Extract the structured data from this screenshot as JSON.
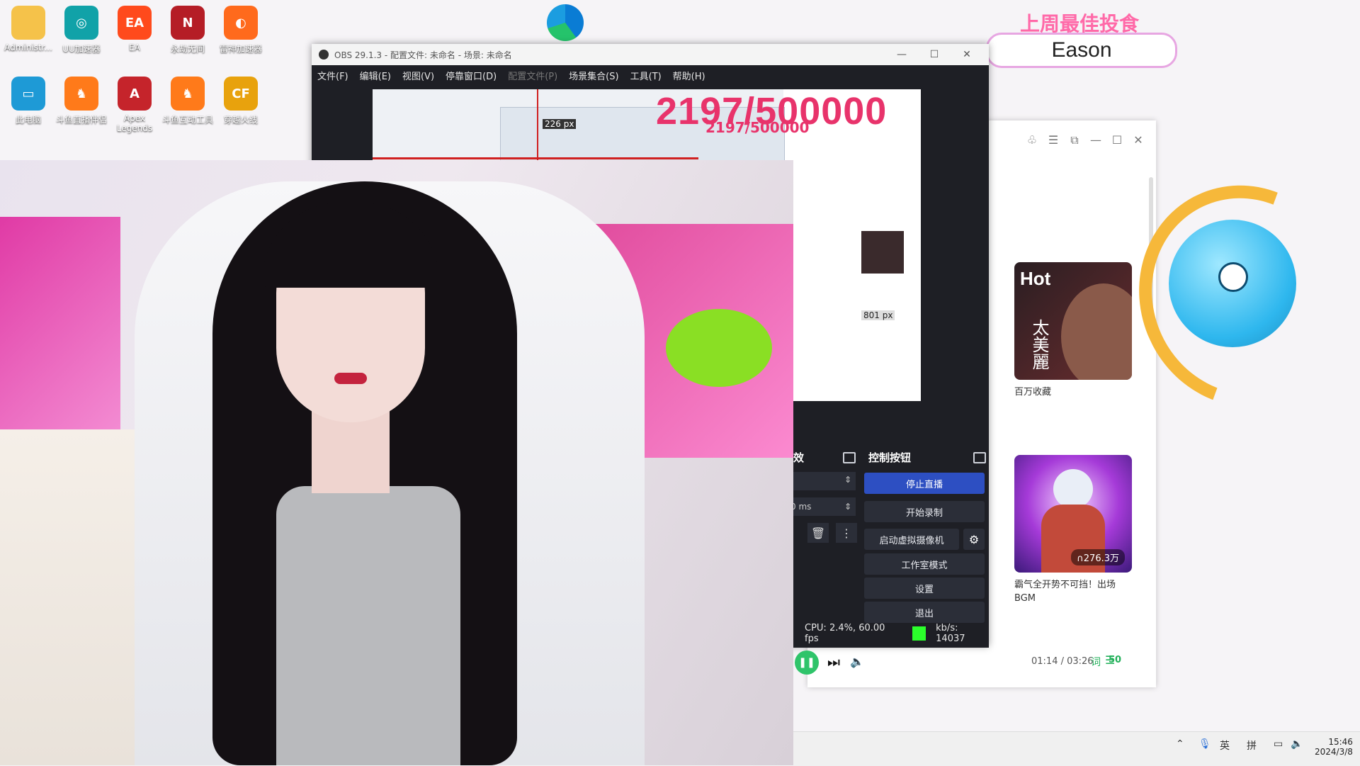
{
  "desktop": {
    "icons": [
      {
        "label": "Administr...",
        "icon": "folder-icon",
        "color": "#f5c24a",
        "glyph": ""
      },
      {
        "label": "UU加速器",
        "icon": "uu-accelerator-icon",
        "color": "#11a2a8",
        "glyph": "◎"
      },
      {
        "label": "EA",
        "icon": "ea-icon",
        "color": "#ff4a1c",
        "glyph": "EA"
      },
      {
        "label": "永劫无间",
        "icon": "naraka-icon",
        "color": "#b51d26",
        "glyph": "N"
      },
      {
        "label": "雷神加速器",
        "icon": "leishen-icon",
        "color": "#ff6a1c",
        "glyph": "◐"
      },
      {
        "label": "此电脑",
        "icon": "this-pc-icon",
        "color": "#1e9ad6",
        "glyph": "▭"
      },
      {
        "label": "斗鱼直播伴侣",
        "icon": "douyu-companion-icon",
        "color": "#ff7a1a",
        "glyph": "♞"
      },
      {
        "label": "Apex Legends",
        "icon": "apex-icon",
        "color": "#c5242b",
        "glyph": "A"
      },
      {
        "label": "斗鱼互动工具",
        "icon": "douyu-tool-icon",
        "color": "#ff7a1a",
        "glyph": "♞"
      },
      {
        "label": "穿越火线",
        "icon": "crossfire-icon",
        "color": "#e8a20d",
        "glyph": "CF"
      }
    ]
  },
  "overlay": {
    "badge_title": "上周最佳投食",
    "badge_name": "Eason"
  },
  "obs": {
    "title": "OBS 29.1.3 - 配置文件: 未命名 - 场景: 未命名",
    "menu": [
      "文件(F)",
      "编辑(E)",
      "视图(V)",
      "停靠窗口(D)",
      "配置文件(P)",
      "场景集合(S)",
      "工具(T)",
      "帮助(H)"
    ],
    "preview_counter": "2197/500000",
    "mini_counter": "2197/500000",
    "px_label_1": "226 px",
    "px_label_2": "801 px",
    "panel_partial_title": "效",
    "partial_ms": "0 ms",
    "controls": {
      "title": "控制按钮",
      "stop_stream": "停止直播",
      "start_record": "开始录制",
      "start_virtual_cam": "启动虚拟摄像机",
      "studio_mode": "工作室模式",
      "settings": "设置",
      "exit": "退出"
    },
    "status": {
      "cpu": "CPU: 2.4%, 60.00 fps",
      "kbs": "kb/s: 14037"
    }
  },
  "music": {
    "cards": [
      {
        "tag": "Hot",
        "label": "百万收藏",
        "art_text": "太美麗",
        "colors": [
          "#2a1e22",
          "#6a2c2e"
        ]
      },
      {
        "tag": "",
        "label": "霸气全开势不可挡！出场BGM",
        "plays": "∩276.3万",
        "colors": [
          "#3b1a7a",
          "#a53ad8"
        ]
      }
    ],
    "time": "01:14 / 03:26",
    "lyrics_label": "词",
    "queue_count": "50"
  },
  "taskbar": {
    "lang": "英",
    "ime": "拼",
    "time": "15:46",
    "date": "2024/3/8"
  }
}
